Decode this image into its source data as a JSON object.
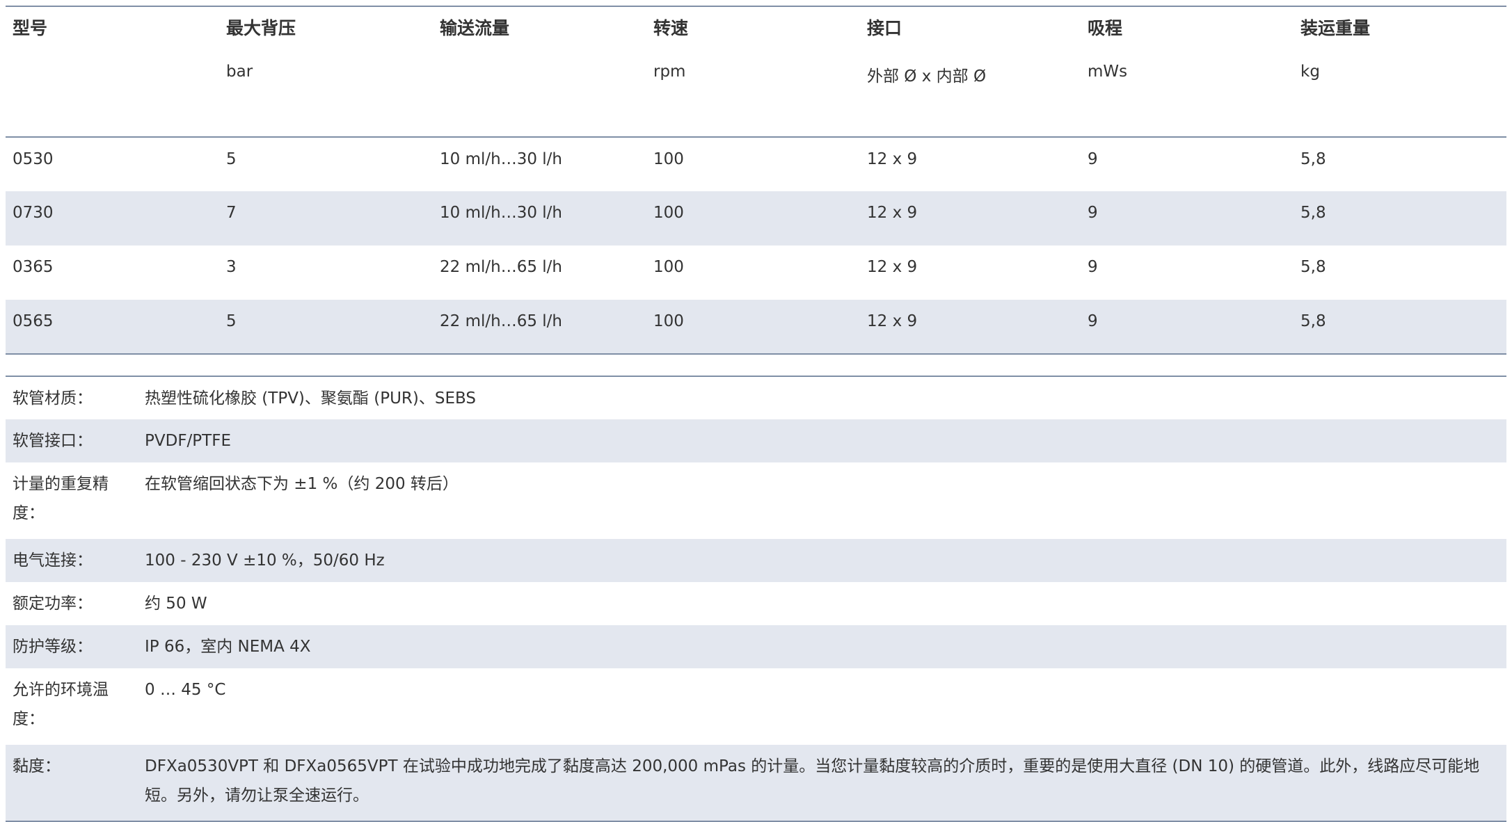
{
  "spec_table": {
    "headers": [
      "型号",
      "最大背压",
      "输送流量",
      "转速",
      "接口",
      "吸程",
      "装运重量"
    ],
    "units": [
      "",
      "bar",
      "",
      "rpm",
      "外部 Ø x 内部 Ø",
      "mWs",
      "kg"
    ],
    "rows": [
      [
        "0530",
        "5",
        "10 ml/h…30 l/h",
        "100",
        "12 x 9",
        "9",
        "5,8"
      ],
      [
        "0730",
        "7",
        "10 ml/h…30 l/h",
        "100",
        "12 x 9",
        "9",
        "5,8"
      ],
      [
        "0365",
        "3",
        "22 ml/h…65 l/h",
        "100",
        "12 x 9",
        "9",
        "5,8"
      ],
      [
        "0565",
        "5",
        "22 ml/h…65 l/h",
        "100",
        "12 x 9",
        "9",
        "5,8"
      ]
    ]
  },
  "properties": [
    {
      "key": "软管材质：",
      "value": "热塑性硫化橡胶 (TPV)、聚氨酯 (PUR)、SEBS"
    },
    {
      "key": "软管接口：",
      "value": "PVDF/PTFE"
    },
    {
      "key": "计量的重复精度：",
      "value": "在软管缩回状态下为 ±1 %（约 200 转后）"
    },
    {
      "key": "电气连接：",
      "value": "100 - 230 V ±10 %，50/60 Hz"
    },
    {
      "key": "额定功率：",
      "value": "约 50 W"
    },
    {
      "key": "防护等级：",
      "value": "IP 66，室内 NEMA 4X"
    },
    {
      "key": "允许的环境温度：",
      "value": "0 … 45 °C"
    },
    {
      "key": "黏度：",
      "value": "DFXa0530VPT 和 DFXa0565VPT 在试验中成功地完成了黏度高达 200,000 mPas 的计量。当您计量黏度较高的介质时，重要的是使用大直径 (DN 10) 的硬管道。此外，线路应尽可能地短。另外，请勿让泵全速运行。"
    }
  ],
  "colors": {
    "border": "#7f8fa6",
    "stripe": "#e3e7ef",
    "text": "#333333"
  }
}
